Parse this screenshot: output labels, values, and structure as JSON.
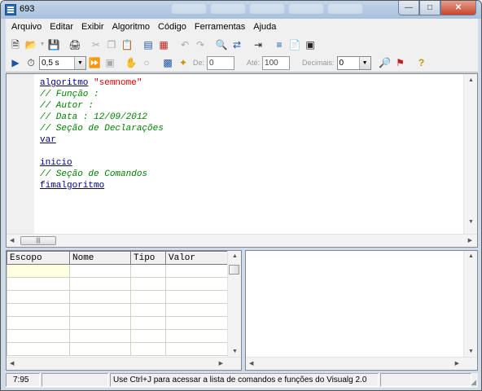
{
  "window": {
    "title": "693"
  },
  "menu": [
    "Arquivo",
    "Editar",
    "Exibir",
    "Algoritmo",
    "Código",
    "Ferramentas",
    "Ajuda"
  ],
  "toolbar2": {
    "speed": "0,5 s",
    "de_label": "De:",
    "de_value": "0",
    "ate_label": "Até:",
    "ate_value": "100",
    "decimais_label": "Decimais:",
    "decimais_value": "0"
  },
  "editor": {
    "lines": [
      [
        {
          "t": "algoritmo",
          "c": "kw"
        },
        {
          "t": " ",
          "c": ""
        },
        {
          "t": "\"semnome\"",
          "c": "str"
        }
      ],
      [
        {
          "t": "// Função :",
          "c": "cm"
        }
      ],
      [
        {
          "t": "// Autor :",
          "c": "cm"
        }
      ],
      [
        {
          "t": "// Data : 12/09/2012",
          "c": "cm"
        }
      ],
      [
        {
          "t": "// Seção de Declarações",
          "c": "cm"
        }
      ],
      [
        {
          "t": "var",
          "c": "kw"
        }
      ],
      [],
      [
        {
          "t": "inicio",
          "c": "kw"
        }
      ],
      [
        {
          "t": "// Seção de Comandos",
          "c": "cm"
        }
      ],
      [
        {
          "t": "fimalgoritmo",
          "c": "kw"
        }
      ]
    ]
  },
  "variables": {
    "columns": [
      "Escopo",
      "Nome",
      "Tipo",
      "Valor"
    ],
    "row_count": 7
  },
  "status": {
    "position": "7:95",
    "blank": "",
    "message": "Use Ctrl+J para acessar a lista de comandos e funções do Visualg 2.0"
  },
  "icons": {
    "app": "visualg-app-icon",
    "close": "close-icon"
  }
}
